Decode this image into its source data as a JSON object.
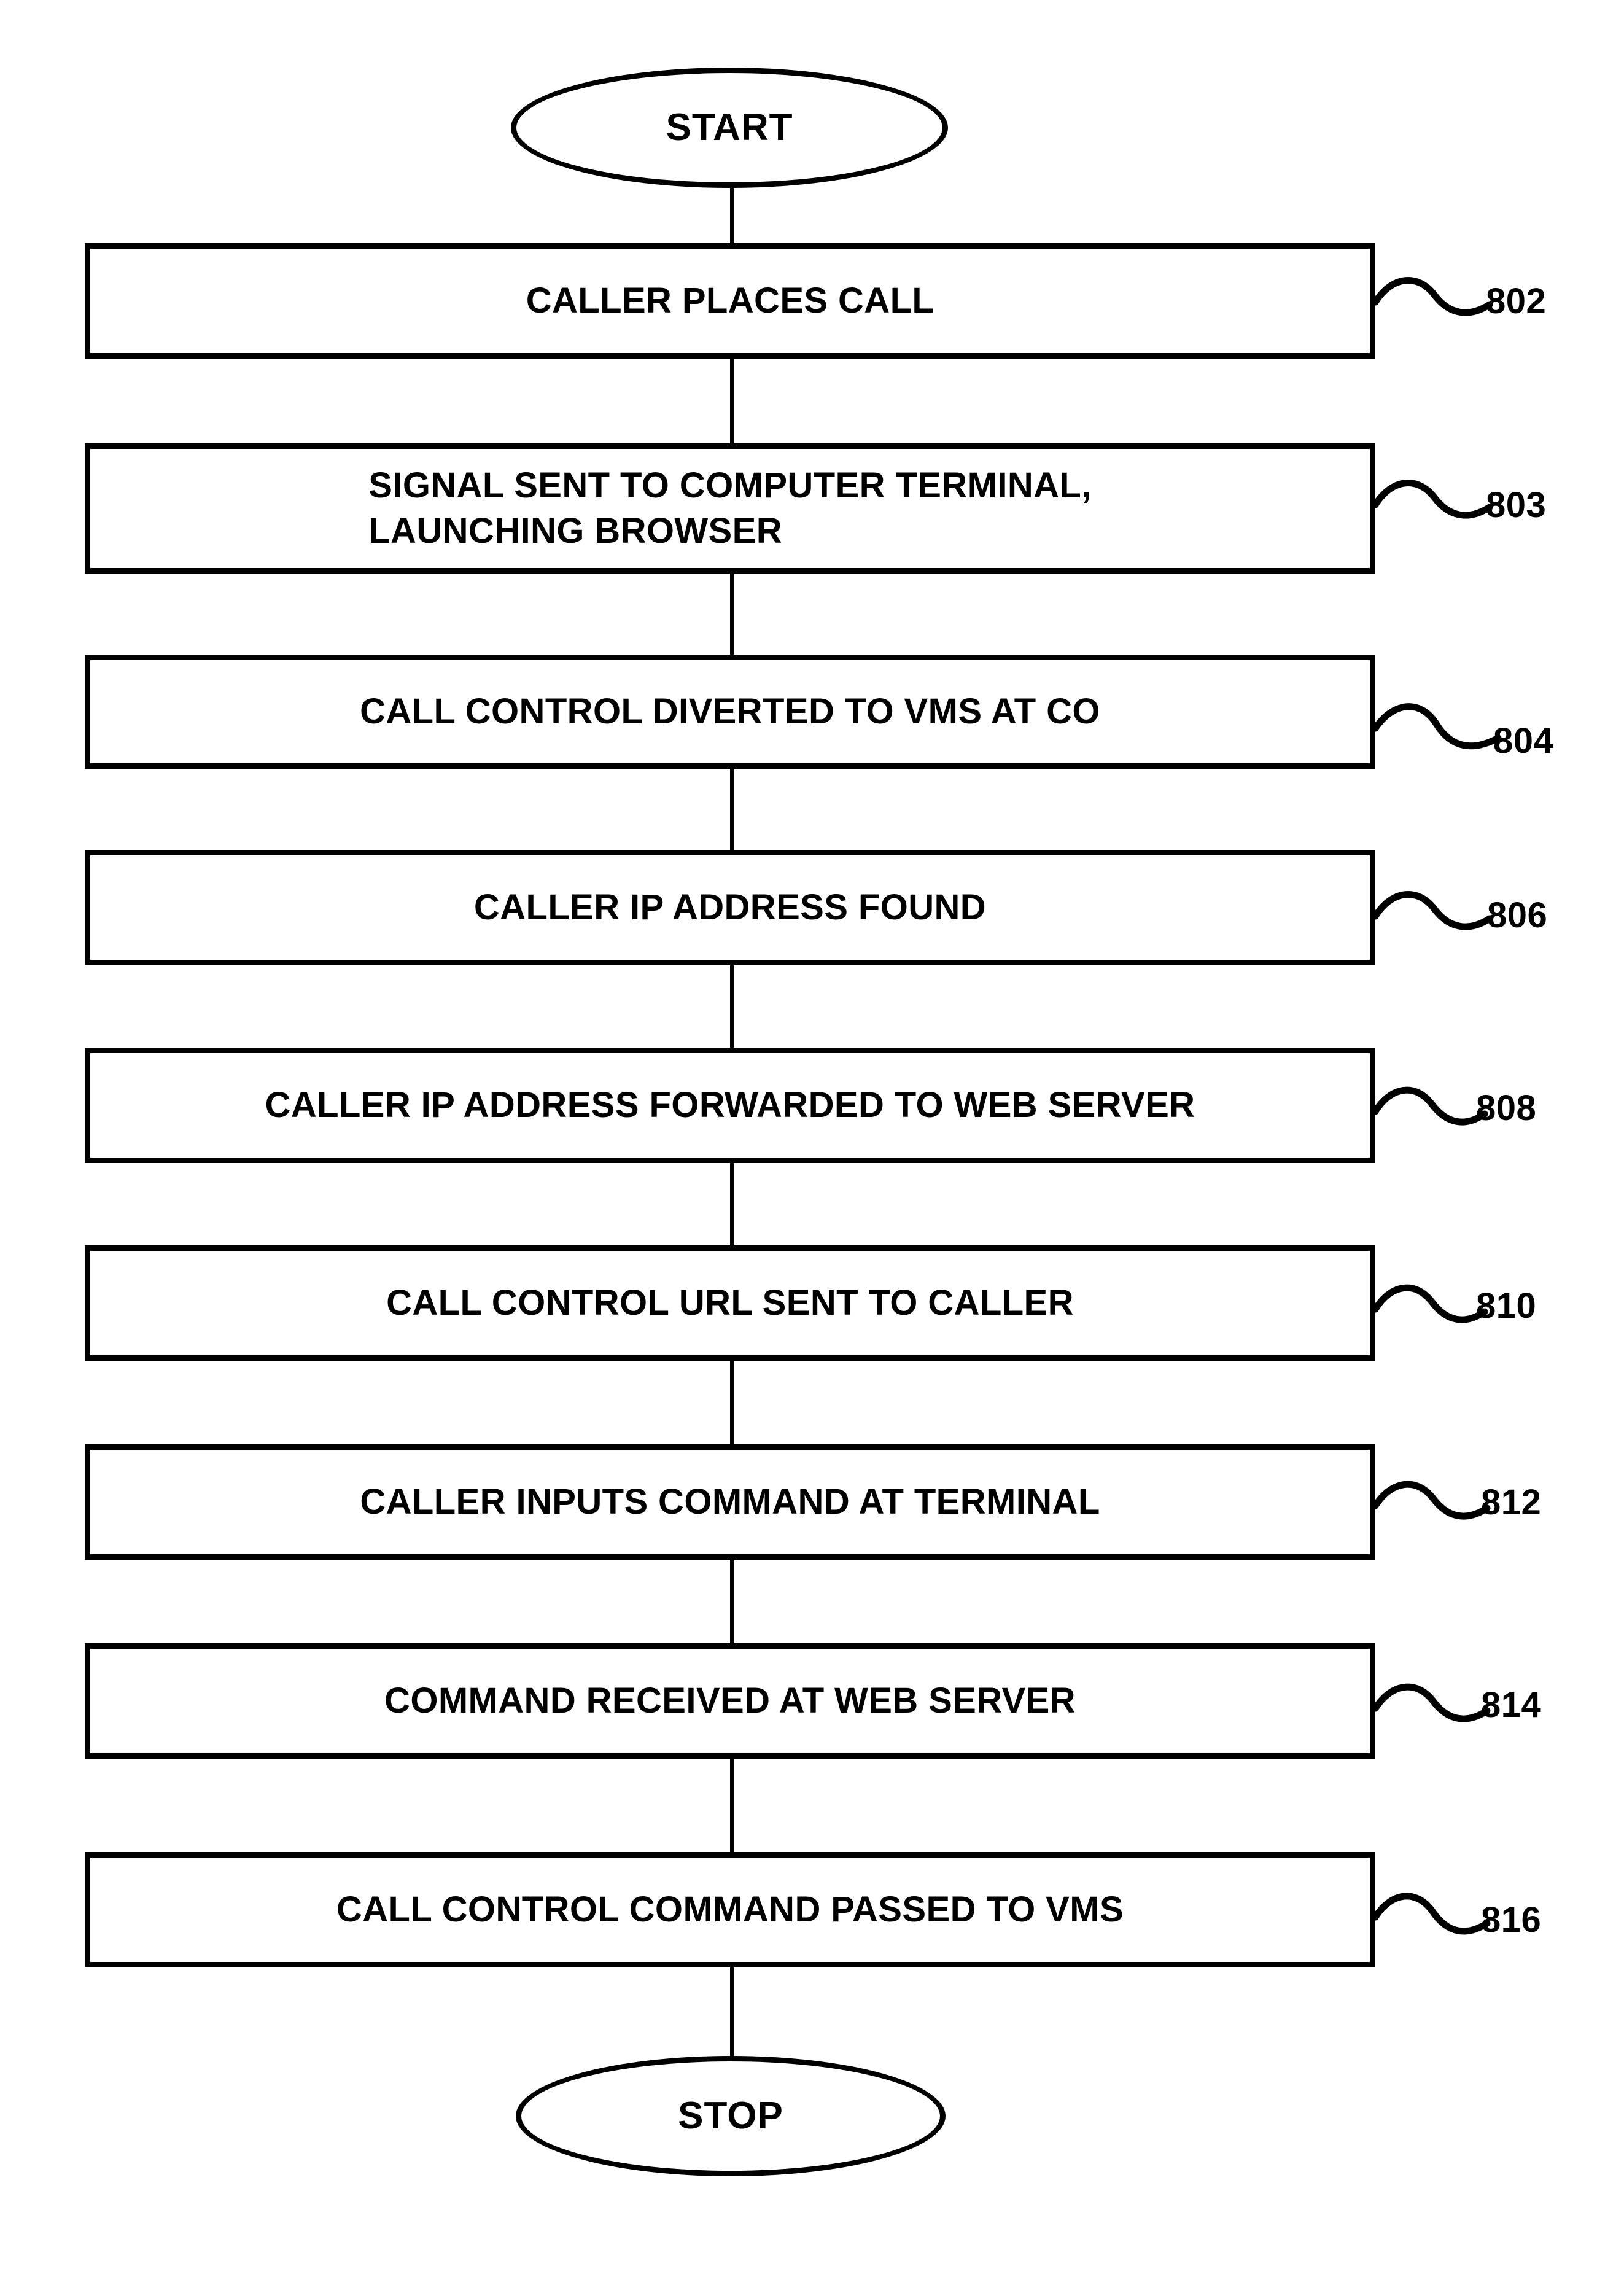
{
  "diagram": {
    "type": "flowchart",
    "orientation": "vertical",
    "figure_style": "patent-drawing",
    "line_color": "#000000",
    "background_color": "#ffffff",
    "start_terminator": "START",
    "stop_terminator": "STOP",
    "steps": [
      {
        "id": "802",
        "text": "CALLER PLACES CALL",
        "lines": 1
      },
      {
        "id": "803",
        "text": "SIGNAL SENT TO COMPUTER TERMINAL,\nLAUNCHING BROWSER",
        "lines": 2
      },
      {
        "id": "804",
        "text": "CALL CONTROL DIVERTED TO VMS AT CO",
        "lines": 1
      },
      {
        "id": "806",
        "text": "CALLER IP ADDRESS FOUND",
        "lines": 1
      },
      {
        "id": "808",
        "text": "CALLER IP ADDRESS FORWARDED TO WEB SERVER",
        "lines": 1
      },
      {
        "id": "810",
        "text": "CALL CONTROL URL SENT TO CALLER",
        "lines": 1
      },
      {
        "id": "812",
        "text": "CALLER INPUTS COMMAND AT TERMINAL",
        "lines": 1
      },
      {
        "id": "814",
        "text": "COMMAND RECEIVED AT WEB SERVER",
        "lines": 1
      },
      {
        "id": "816",
        "text": "CALL CONTROL COMMAND PASSED TO VMS",
        "lines": 1
      }
    ]
  }
}
